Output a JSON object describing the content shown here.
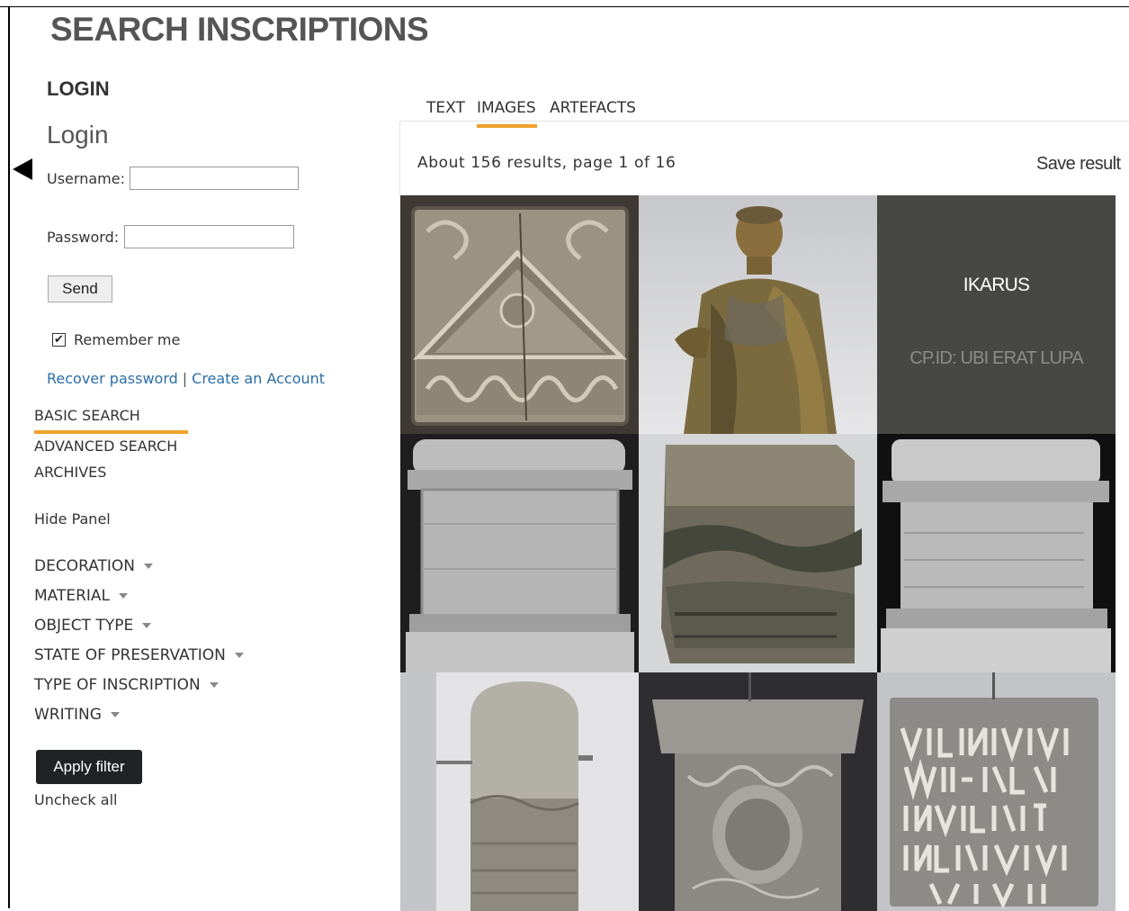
{
  "page": {
    "title": "SEARCH INSCRIPTIONS"
  },
  "login": {
    "section_heading": "LOGIN",
    "title": "Login",
    "username_label": "Username:",
    "username_value": "",
    "password_label": "Password:",
    "password_value": "",
    "send_label": "Send",
    "remember_label": "Remember me",
    "remember_checked": true,
    "recover_label": "Recover password",
    "separator": "|",
    "create_label": "Create an Account"
  },
  "nav": {
    "items": [
      {
        "label": "BASIC SEARCH",
        "active": true
      },
      {
        "label": "ADVANCED SEARCH",
        "active": false
      },
      {
        "label": "ARCHIVES",
        "active": false
      }
    ],
    "hide_panel": "Hide Panel"
  },
  "filters": {
    "items": [
      {
        "label": "DECORATION"
      },
      {
        "label": "MATERIAL"
      },
      {
        "label": "OBJECT TYPE"
      },
      {
        "label": "STATE OF PRESERVATION"
      },
      {
        "label": "TYPE OF INSCRIPTION"
      },
      {
        "label": "WRITING"
      }
    ],
    "apply_label": "Apply filter",
    "uncheck_label": "Uncheck all"
  },
  "tabs": {
    "items": [
      {
        "label": "TEXT",
        "active": false
      },
      {
        "label": "IMAGES",
        "active": true
      },
      {
        "label": "ARTEFACTS",
        "active": false
      }
    ]
  },
  "results": {
    "summary": "About 156 results, page 1 of 16",
    "save_label": "Save result"
  },
  "image_grid": {
    "card_title": "IKARUS",
    "card_subtitle": "CP.ID: UBI ERAT LUPA"
  },
  "colors": {
    "accent": "#f0a22a",
    "link": "#2a6ea6",
    "apply_button": "#1f2325",
    "card_background": "#474843"
  }
}
